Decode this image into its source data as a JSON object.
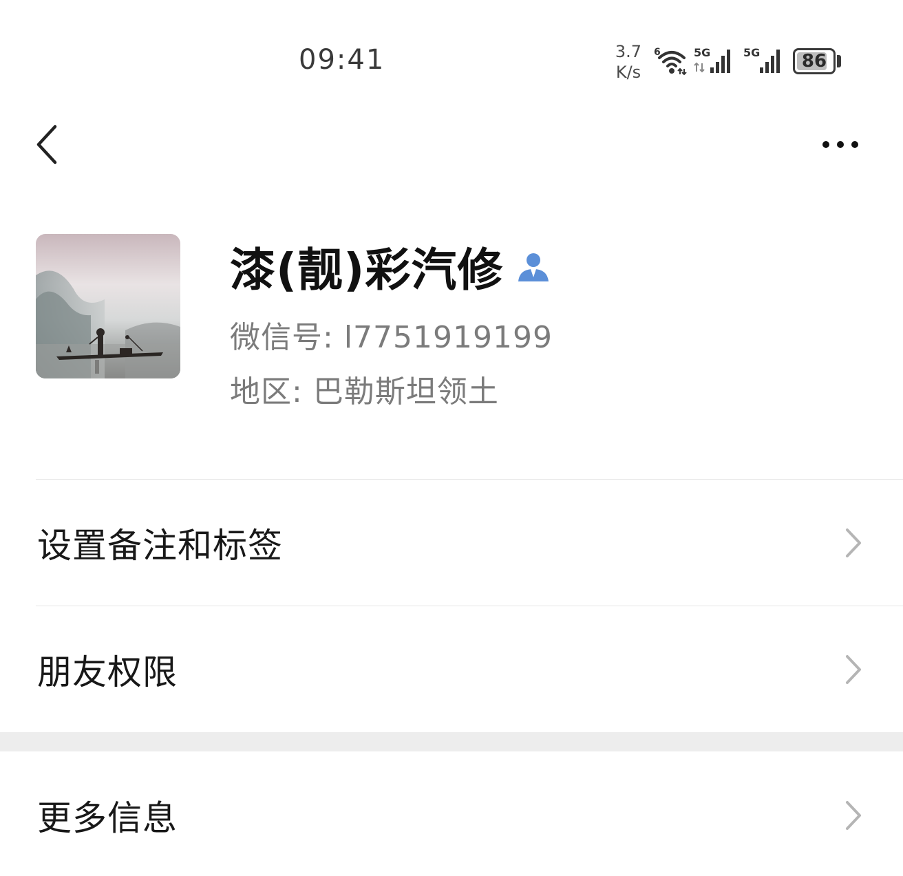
{
  "status_bar": {
    "time": "09:41",
    "net_speed_value": "3.7",
    "net_speed_unit": "K/s",
    "wifi_label": "6",
    "sim1_label": "5G",
    "sim2_label": "5G",
    "battery_level": 86,
    "battery_text": "86",
    "icons": [
      "wifi-icon",
      "signal-icon",
      "signal-icon",
      "battery-icon"
    ]
  },
  "nav": {
    "back_icon": "back-chevron-icon",
    "more_icon": "more-dots-icon"
  },
  "profile": {
    "name": "漆(靓)彩汽修",
    "wechat_id_label": "微信号:",
    "wechat_id": "l7751919199",
    "region_label": "地区:",
    "region": "巴勒斯坦领土",
    "contact_icon": "contact-person-icon",
    "accent_color": "#5b8fd8"
  },
  "menu": {
    "items": [
      {
        "label": "设置备注和标签",
        "icon": "chevron-right-icon"
      },
      {
        "label": "朋友权限",
        "icon": "chevron-right-icon"
      },
      {
        "label": "更多信息",
        "icon": "chevron-right-icon"
      }
    ]
  },
  "colors": {
    "background": "#ffffff",
    "divider": "#e6e6e6",
    "section_gap": "#ededed",
    "secondary_text": "#7b7b7b",
    "chevron": "#b5b5b5"
  }
}
